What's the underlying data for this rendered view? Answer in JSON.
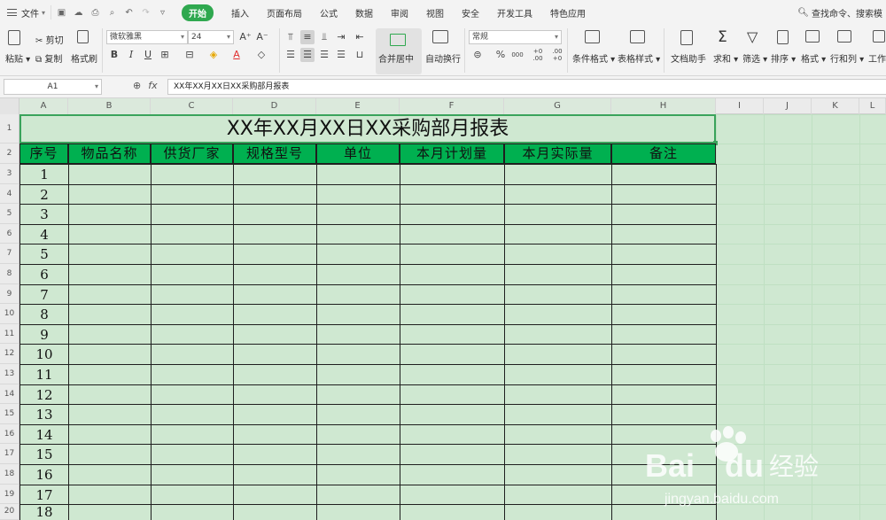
{
  "menu": {
    "file": "文件",
    "tabs": [
      "开始",
      "插入",
      "页面布局",
      "公式",
      "数据",
      "审阅",
      "视图",
      "安全",
      "开发工具",
      "特色应用"
    ],
    "active_tab": "开始",
    "search": "查找命令、搜索模"
  },
  "ribbon": {
    "paste": "粘贴",
    "cut": "剪切",
    "copy": "复制",
    "format_painter": "格式刷",
    "font_name": "微软雅黑",
    "font_size": "24",
    "bold": "B",
    "italic": "I",
    "underline": "U",
    "merge_center": "合并居中",
    "wrap_text": "自动换行",
    "number_format": "常规",
    "percent": "%",
    "thousands": "000",
    "dec_inc": "+0 .00",
    "dec_dec": ".00 +0",
    "conditional_format": "条件格式",
    "table_style": "表格样式",
    "doc_helper": "文档助手",
    "sum": "求和",
    "filter": "筛选",
    "sort": "排序",
    "format": "格式",
    "rows_cols": "行和列",
    "worksheet": "工作"
  },
  "formula_bar": {
    "cell_ref": "A1",
    "fx": "fx",
    "content": "XX年XX月XX日XX采购部月报表"
  },
  "sheet": {
    "columns": [
      "A",
      "B",
      "C",
      "D",
      "E",
      "F",
      "G",
      "H",
      "I",
      "J",
      "K",
      "L"
    ],
    "rows": [
      "1",
      "2",
      "3",
      "4",
      "5",
      "6",
      "7",
      "8",
      "9",
      "10",
      "11",
      "12",
      "13",
      "14",
      "15",
      "16",
      "17",
      "18",
      "19",
      "20"
    ],
    "title": "XX年XX月XX日XX采购部月报表",
    "headers": [
      "序号",
      "物品名称",
      "供货厂家",
      "规格型号",
      "单位",
      "本月计划量",
      "本月实际量",
      "备注"
    ],
    "serials": [
      "1",
      "2",
      "3",
      "4",
      "5",
      "6",
      "7",
      "8",
      "9",
      "10",
      "11",
      "12",
      "13",
      "14",
      "15",
      "16",
      "17",
      "18"
    ]
  },
  "colors": {
    "accent": "#2fa84f",
    "header_fill": "#00b050",
    "sheet_bg": "#cfe8d1",
    "selection": "#3aa35b"
  },
  "watermark": {
    "brand": "Bai",
    "brand2": "du",
    "cn": "经验",
    "url": "jingyan.baidu.com"
  }
}
